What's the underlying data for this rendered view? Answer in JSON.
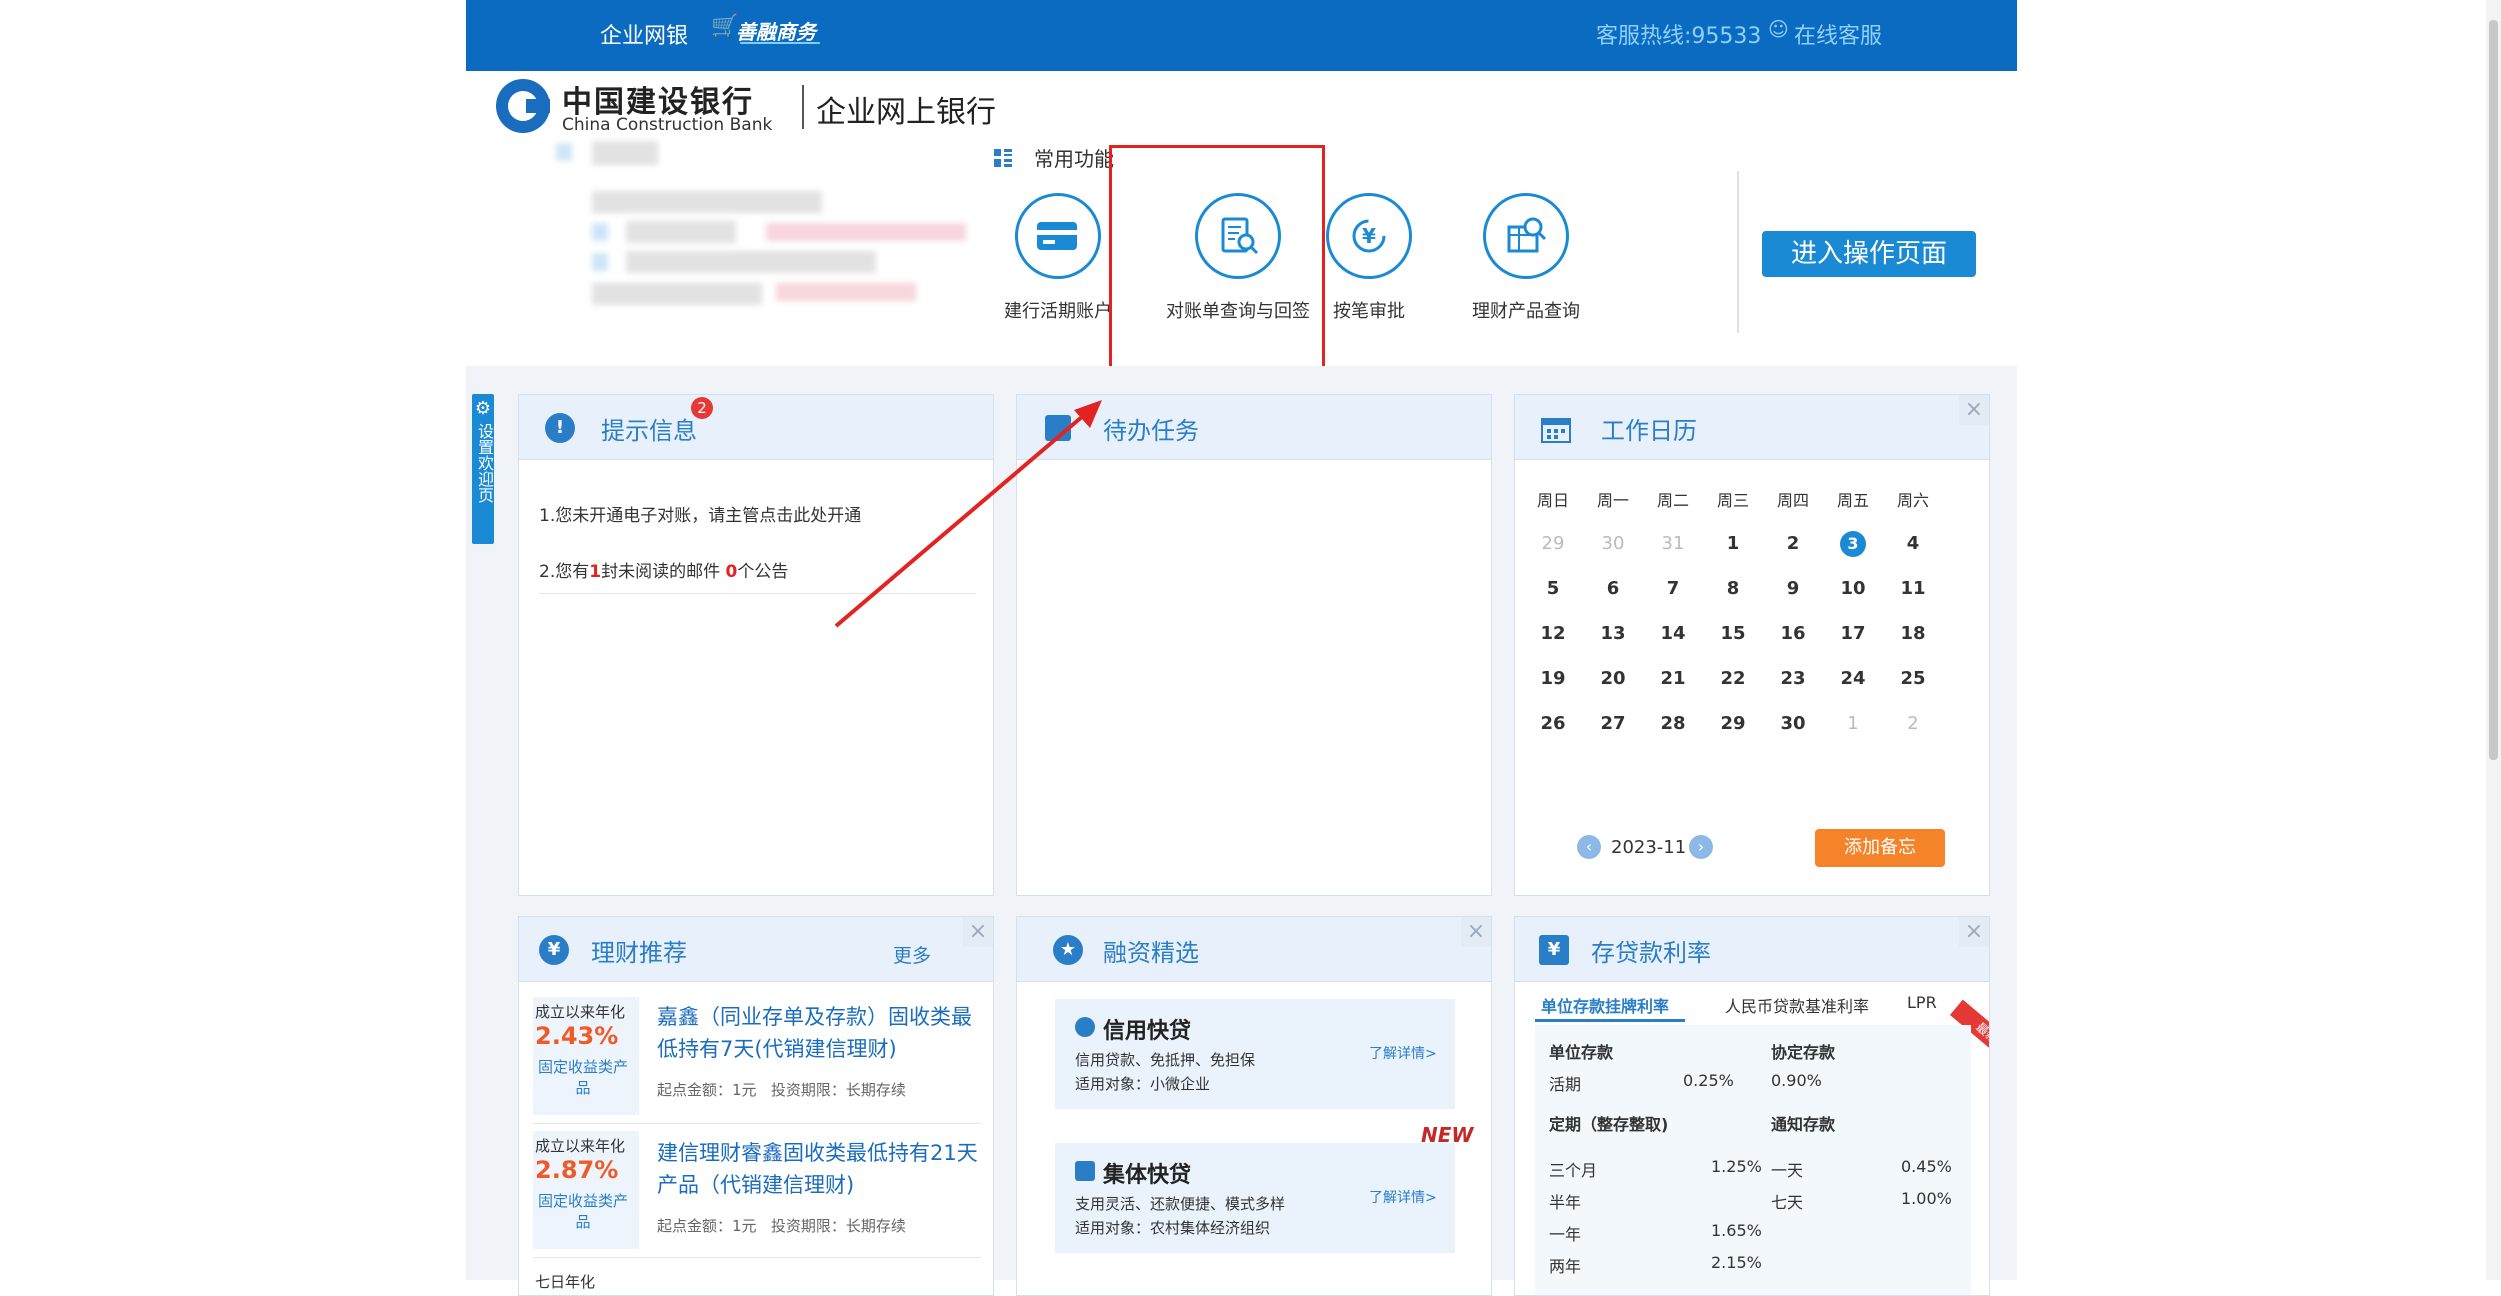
{
  "topbar": {
    "nav_corp": "企业网银",
    "nav_shanrong": "善融商务",
    "hotline": "客服热线:95533",
    "online_service": "在线客服"
  },
  "brand": {
    "bank_cn": "中国建设银行",
    "bank_en": "China Construction Bank",
    "product": "企业网上银行"
  },
  "common": {
    "title": "常用功能",
    "items": [
      {
        "label": "建行活期账户",
        "icon": "card-icon"
      },
      {
        "label": "对账单查询与回签",
        "icon": "document-search-icon"
      },
      {
        "label": "按笔审批",
        "icon": "yen-approve-icon"
      },
      {
        "label": "理财产品查询",
        "icon": "finance-search-icon"
      }
    ],
    "enter_button": "进入操作页面"
  },
  "side_tab": {
    "icon": "gear-icon",
    "label": "设置欢迎页"
  },
  "tips": {
    "title": "提示信息",
    "badge": "2",
    "line1": "1.您未开通电子对账，请主管点击此处开通",
    "line2_pre": "2.您有",
    "line2_n1": "1",
    "line2_mid": "封未阅读的邮件 ",
    "line2_n2": "0",
    "line2_post": "个公告"
  },
  "todo": {
    "title": "待办任务"
  },
  "calendar": {
    "title": "工作日历",
    "weekdays": [
      "周日",
      "周一",
      "周二",
      "周三",
      "周四",
      "周五",
      "周六"
    ],
    "weeks": [
      [
        "29",
        "30",
        "31",
        "1",
        "2",
        "3",
        "4"
      ],
      [
        "5",
        "6",
        "7",
        "8",
        "9",
        "10",
        "11"
      ],
      [
        "12",
        "13",
        "14",
        "15",
        "16",
        "17",
        "18"
      ],
      [
        "19",
        "20",
        "21",
        "22",
        "23",
        "24",
        "25"
      ],
      [
        "26",
        "27",
        "28",
        "29",
        "30",
        "1",
        "2"
      ]
    ],
    "today": "3",
    "month": "2023-11",
    "add_note": "添加备忘"
  },
  "wealth": {
    "title": "理财推荐",
    "more": "更多",
    "products": [
      {
        "since": "成立以来年化",
        "rate": "2.43%",
        "type": "固定收益类产品",
        "name": "嘉鑫（同业存单及存款）固收类最低持有7天(代销建信理财)",
        "min_label": "起点金额：",
        "min": "1元",
        "term_label": "投资期限：",
        "term": "长期存续"
      },
      {
        "since": "成立以来年化",
        "rate": "2.87%",
        "type": "固定收益类产品",
        "name": "建信理财睿鑫固收类最低持有21天产品（代销建信理财)",
        "min_label": "起点金额：",
        "min": "1元",
        "term_label": "投资期限：",
        "term": "长期存续"
      }
    ],
    "third_since": "七日年化"
  },
  "financing": {
    "title": "融资精选",
    "cards": [
      {
        "name": "信用快贷",
        "desc1": "信用贷款、免抵押、免担保",
        "desc2": "适用对象：小微企业",
        "link": "了解详情>"
      },
      {
        "name": "集体快贷",
        "desc1": "支用灵活、还款便捷、模式多样",
        "desc2": "适用对象：农村集体经济组织",
        "link": "了解详情>",
        "badge": "NEW"
      }
    ]
  },
  "rates": {
    "title": "存贷款利率",
    "tabs": [
      "单位存款挂牌利率",
      "人民币贷款基准利率",
      "LPR"
    ],
    "corner": "最新",
    "sec1_left": "单位存款",
    "sec1_right": "协定存款",
    "demand": {
      "label": "活期",
      "value": "0.25%"
    },
    "agreement": {
      "value": "0.90%"
    },
    "sec2_left": "定期（整存整取)",
    "sec2_right": "通知存款",
    "time_rows": [
      {
        "label": "三个月",
        "value": "1.25%"
      },
      {
        "label": "半年",
        "value": ""
      },
      {
        "label": "一年",
        "value": "1.65%"
      },
      {
        "label": "两年",
        "value": "2.15%"
      }
    ],
    "notice_rows": [
      {
        "label": "一天",
        "value": "0.45%"
      },
      {
        "label": "七天",
        "value": "1.00%"
      }
    ]
  }
}
